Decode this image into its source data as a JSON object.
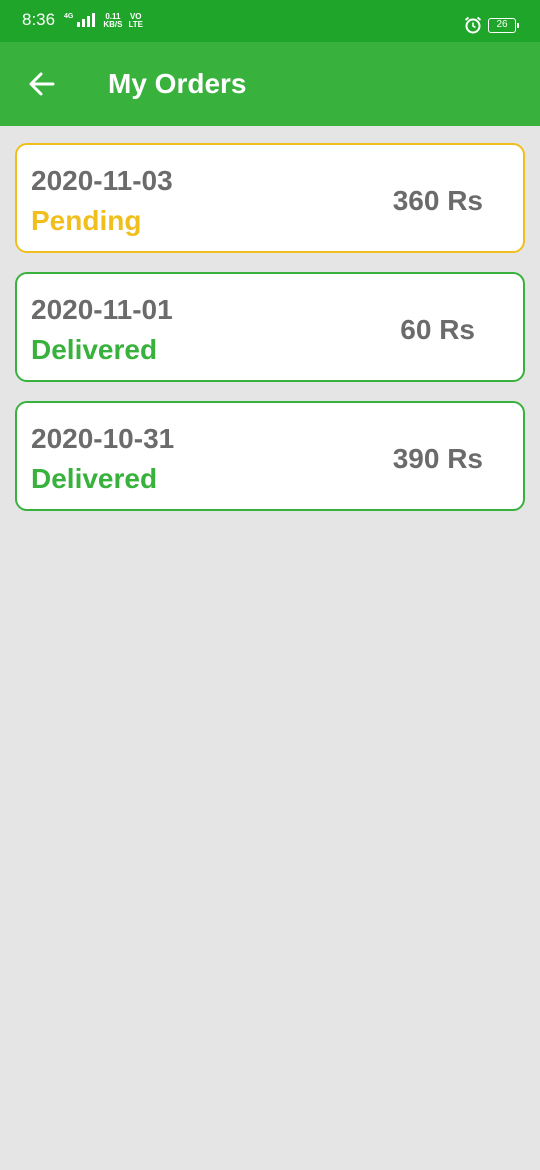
{
  "status_bar": {
    "time": "8:36",
    "network_type": "4G",
    "speed_value": "0.11",
    "speed_unit": "KB/S",
    "volte_top": "VO",
    "volte_bottom": "LTE",
    "battery": "26",
    "icons": [
      "signal-icon",
      "alarm-icon",
      "battery-icon"
    ]
  },
  "app_bar": {
    "title": "My Orders",
    "back_icon": "arrow-left-icon",
    "color": "#38b23c"
  },
  "orders": [
    {
      "date": "2020-11-03",
      "status": "Pending",
      "amount": "360 Rs",
      "status_color": "#f1bf1d"
    },
    {
      "date": "2020-11-01",
      "status": "Delivered",
      "amount": "60 Rs",
      "status_color": "#38b23c"
    },
    {
      "date": "2020-10-31",
      "status": "Delivered",
      "amount": "390 Rs",
      "status_color": "#38b23c"
    }
  ],
  "colors": {
    "status_bar": "#1ea52a",
    "background": "#e5e5e5",
    "pending": "#f1bf1d",
    "delivered": "#38b23c",
    "text_gray": "#6b6b6b"
  }
}
